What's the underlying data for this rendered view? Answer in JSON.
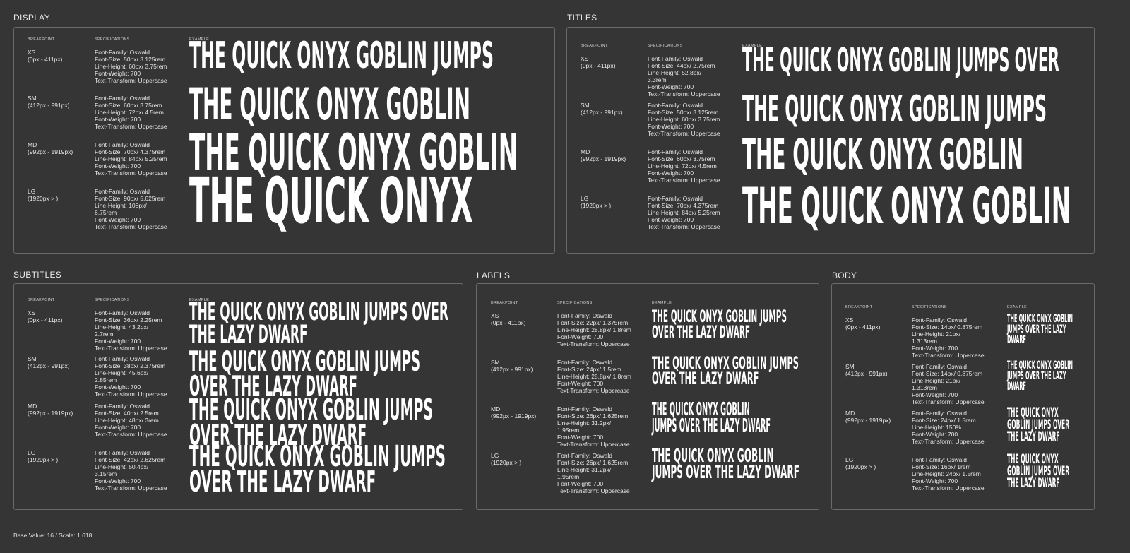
{
  "headers": {
    "breakpoint": "BREAKPOINT",
    "specifications": "SPECIFICATIONS",
    "example": "EXAMPLE"
  },
  "footer": "Base Value: 16 / Scale: 1.618",
  "sections": [
    {
      "title": "DISPLAY",
      "rows": [
        {
          "bp": "XS",
          "range": "(0px - 411px)",
          "spec": [
            "Font-Family: Oswald",
            "Font-Size: 50px/ 3.125rem",
            "Line-Height: 60px/ 3.75rem",
            "Font-Weight: 700",
            "Text-Transform: Uppercase"
          ],
          "example": [
            "THE QUICK ONYX GOBLIN JUMPS"
          ]
        },
        {
          "bp": "SM",
          "range": "(412px - 991px)",
          "spec": [
            "Font-Family: Oswald",
            "Font-Size: 60px/ 3.75rem",
            "Line-Height: 72px/ 4.5rem",
            "Font-Weight: 700",
            "Text-Transform: Uppercase"
          ],
          "example": [
            "THE QUICK ONYX GOBLIN"
          ]
        },
        {
          "bp": "MD",
          "range": "(992px - 1919px)",
          "spec": [
            "Font-Family: Oswald",
            "Font-Size: 70px/ 4.375rem",
            "Line-Height: 84px/ 5.25rem",
            "Font-Weight: 700",
            "Text-Transform: Uppercase"
          ],
          "example": [
            "THE QUICK ONYX GOBLIN"
          ]
        },
        {
          "bp": "LG",
          "range": "(1920px > )",
          "spec": [
            "Font-Family: Oswald",
            "Font-Size: 90px/ 5.625rem",
            "Line-Height: 108px/",
            "6.75rem",
            "Font-Weight: 700",
            "Text-Transform: Uppercase"
          ],
          "example": [
            "THE QUICK ONYX"
          ]
        }
      ]
    },
    {
      "title": "TITLES",
      "rows": [
        {
          "bp": "XS",
          "range": "(0px - 411px)",
          "spec": [
            "Font-Family: Oswald",
            "Font-Size: 44px/ 2.75rem",
            "Line-Height: 52.8px/",
            "3.3rem",
            "Font-Weight: 700",
            "Text-Transform: Uppercase"
          ],
          "example": [
            "THE QUICK ONYX GOBLIN JUMPS OVER"
          ]
        },
        {
          "bp": "SM",
          "range": "(412px - 991px)",
          "spec": [
            "Font-Family: Oswald",
            "Font-Size: 50px/ 3.125rem",
            "Line-Height: 60px/ 3.75rem",
            "Font-Weight: 700",
            "Text-Transform: Uppercase"
          ],
          "example": [
            "THE QUICK ONYX GOBLIN JUMPS"
          ]
        },
        {
          "bp": "MD",
          "range": "(992px - 1919px)",
          "spec": [
            "Font-Family: Oswald",
            "Font-Size: 60px/ 3.75rem",
            "Line-Height: 72px/ 4.5rem",
            "Font-Weight: 700",
            "Text-Transform: Uppercase"
          ],
          "example": [
            "THE QUICK ONYX GOBLIN"
          ]
        },
        {
          "bp": "LG",
          "range": "(1920px > )",
          "spec": [
            "Font-Family: Oswald",
            "Font-Size: 70px/ 4.375rem",
            "Line-Height: 84px/ 5.25rem",
            "Font-Weight: 700",
            "Text-Transform: Uppercase"
          ],
          "example": [
            "THE QUICK ONYX GOBLIN"
          ]
        }
      ]
    },
    {
      "title": "SUBTITLES",
      "rows": [
        {
          "bp": "XS",
          "range": "(0px - 411px)",
          "spec": [
            "Font-Family: Oswald",
            "Font-Size: 36px/ 2.25rem",
            "Line-Height: 43.2px/",
            "2.7rem",
            "Font-Weight: 700",
            "Text-Transform: Uppercase"
          ],
          "example": [
            "THE QUICK ONYX GOBLIN JUMPS OVER",
            "THE LAZY DWARF"
          ]
        },
        {
          "bp": "SM",
          "range": "(412px - 991px)",
          "spec": [
            "Font-Family: Oswald",
            "Font-Size: 38px/ 2.375rem",
            "Line-Height: 45.6px/",
            "2.85rem",
            "Font-Weight: 700",
            "Text-Transform: Uppercase"
          ],
          "example": [
            "THE QUICK ONYX GOBLIN JUMPS",
            "OVER THE LAZY DWARF"
          ]
        },
        {
          "bp": "MD",
          "range": "(992px - 1919px)",
          "spec": [
            "Font-Family: Oswald",
            "Font-Size: 40px/ 2.5rem",
            "Line-Height: 48px/ 3rem",
            "Font-Weight: 700",
            "Text-Transform: Uppercase"
          ],
          "example": [
            "THE QUICK ONYX GOBLIN JUMPS",
            "OVER THE LAZY DWARF"
          ]
        },
        {
          "bp": "LG",
          "range": "(1920px > )",
          "spec": [
            "Font-Family: Oswald",
            "Font-Size: 42px/ 2.625rem",
            "Line-Height: 50.4px/",
            "3.15rem",
            "Font-Weight: 700",
            "Text-Transform: Uppercase"
          ],
          "example": [
            "THE QUICK ONYX GOBLIN JUMPS",
            "OVER THE LAZY DWARF"
          ]
        }
      ]
    },
    {
      "title": "LABELS",
      "rows": [
        {
          "bp": "XS",
          "range": "(0px - 411px)",
          "spec": [
            "Font-Family: Oswald",
            "Font-Size: 22px/ 1.375rem",
            "Line-Height: 28.8px/ 1.8rem",
            "Font-Weight: 700",
            "Text-Transform: Uppercase"
          ],
          "example": [
            "THE QUICK ONYX GOBLIN JUMPS",
            "OVER THE LAZY DWARF"
          ]
        },
        {
          "bp": "SM",
          "range": "(412px - 991px)",
          "spec": [
            "Font-Family: Oswald",
            "Font-Size: 24px/ 1.5rem",
            "Line-Height: 28.8px/ 1.8rem",
            "Font-Weight: 700",
            "Text-Transform: Uppercase"
          ],
          "example": [
            "THE QUICK ONYX GOBLIN JUMPS",
            "OVER THE LAZY DWARF"
          ]
        },
        {
          "bp": "MD",
          "range": "(992px - 1919px)",
          "spec": [
            "Font-Family: Oswald",
            "Font-Size: 26px/ 1.625rem",
            "Line-Height: 31.2px/",
            "1.95rem",
            "Font-Weight: 700",
            "Text-Transform: Uppercase"
          ],
          "example": [
            "THE QUICK ONYX GOBLIN",
            "JUMPS OVER THE LAZY DWARF"
          ]
        },
        {
          "bp": "LG",
          "range": "(1920px > )",
          "spec": [
            "Font-Family: Oswald",
            "Font-Size: 26px/ 1.625rem",
            "Line-Height: 31.2px/",
            "1.95rem",
            "Font-Weight: 700",
            "Text-Transform: Uppercase"
          ],
          "example": [
            "THE QUICK ONYX GOBLIN",
            "JUMPS OVER THE LAZY DWARF"
          ]
        }
      ]
    },
    {
      "title": "BODY",
      "rows": [
        {
          "bp": "XS",
          "range": "(0px - 411px)",
          "spec": [
            "Font-Family: Oswald",
            "Font-Size: 14px/ 0.875rem",
            "Line-Height: 21px/",
            "1.313rem",
            "Font-Weight: 700",
            "Text-Transform: Uppercase"
          ],
          "example": [
            "THE QUICK ONYX GOBLIN",
            "JUMPS OVER THE LAZY",
            "DWARF"
          ]
        },
        {
          "bp": "SM",
          "range": "(412px - 991px)",
          "spec": [
            "Font-Family: Oswald",
            "Font-Size: 14px/ 0.875rem",
            "Line-Height: 21px/",
            "1.313rem",
            "Font-Weight: 700",
            "Text-Transform: Uppercase"
          ],
          "example": [
            "THE QUICK ONYX GOBLIN",
            "JUMPS OVER THE LAZY",
            "DWARF"
          ]
        },
        {
          "bp": "MD",
          "range": "(992px - 1919px)",
          "spec": [
            "Font-Family: Oswald",
            "Font-Size: 24px/ 1.5rem",
            "Line-Height: 150%",
            "Font-Weight: 700",
            "Text-Transform: Uppercase"
          ],
          "example": [
            "THE QUICK ONYX",
            "GOBLIN JUMPS OVER",
            "THE LAZY DWARF"
          ]
        },
        {
          "bp": "LG",
          "range": "(1920px > )",
          "spec": [
            "Font-Family: Oswald",
            "Font-Size: 16px/ 1rem",
            "Line-Height: 24px/ 1.5rem",
            "Font-Weight: 700",
            "Text-Transform: Uppercase"
          ],
          "example": [
            "THE QUICK ONYX",
            "GOBLIN JUMPS OVER",
            "THE LAZY DWARF"
          ]
        }
      ]
    }
  ]
}
